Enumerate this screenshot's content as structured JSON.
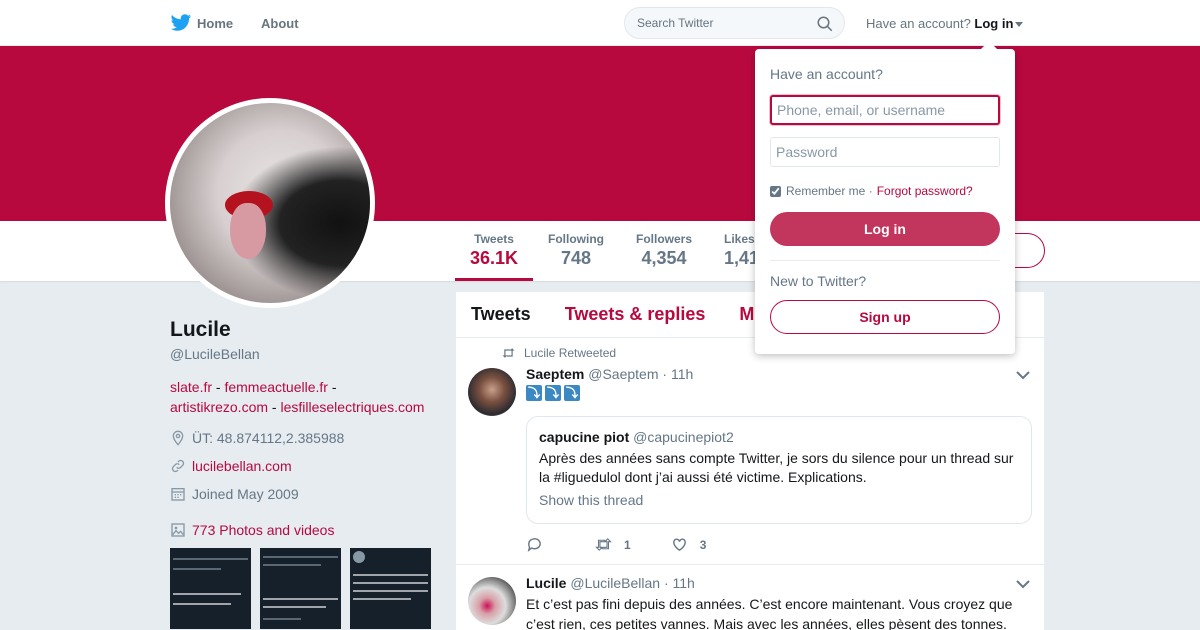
{
  "colors": {
    "accent": "#b8093f",
    "banner": "#b8093f",
    "login_button": "#c2365d",
    "page_bg": "#e6ecf0"
  },
  "nav": {
    "home_label": "Home",
    "about_label": "About",
    "search_placeholder": "Search Twitter",
    "have_account": "Have an account?",
    "login_label": "Log in"
  },
  "profile": {
    "name": "Lucile",
    "handle": "@LucileBellan",
    "bio_links": [
      "slate.fr",
      "femmeactuelle.fr",
      "artistikrezo.com",
      "lesfilleselectriques.com"
    ],
    "bio_sep": " - ",
    "location": "ÜT: 48.874112,2.385988",
    "website": "lucilebellan.com",
    "joined": "Joined May 2009",
    "photos_label": "773 Photos and videos"
  },
  "stats": [
    {
      "label": "Tweets",
      "value": "36.1K"
    },
    {
      "label": "Following",
      "value": "748"
    },
    {
      "label": "Followers",
      "value": "4,354"
    },
    {
      "label": "Likes",
      "value": "1,41"
    }
  ],
  "timeline": {
    "tabs": [
      "Tweets",
      "Tweets & replies",
      "M"
    ],
    "tweets": [
      {
        "retweet_line": "Lucile Retweeted",
        "name": "Saeptem",
        "handle": "@Saeptem",
        "time": "· 11h",
        "emoji": [
          "⤵",
          "⤵",
          "⤵"
        ],
        "quote": {
          "name": "capucine piot",
          "handle": "@capucinepiot2",
          "text": "Après des années sans compte Twitter, je sors du silence pour un thread sur la #liguedulol dont j’ai aussi été victime. Explications.",
          "show_thread": "Show this thread"
        },
        "retweets": "1",
        "likes": "3"
      },
      {
        "name": "Lucile",
        "handle": "@LucileBellan",
        "time": "· 11h",
        "text": "Et c’est pas fini depuis des années. C’est encore maintenant. Vous croyez que c’est rien, ces petites vannes. Mais avec les années, elles pèsent des tonnes."
      }
    ]
  },
  "login_dropdown": {
    "title": "Have an account?",
    "username_placeholder": "Phone, email, or username",
    "password_placeholder": "Password",
    "remember_label": "Remember me ·",
    "forgot_label": "Forgot password?",
    "login_button": "Log in",
    "new_label": "New to Twitter?",
    "signup_button": "Sign up"
  }
}
